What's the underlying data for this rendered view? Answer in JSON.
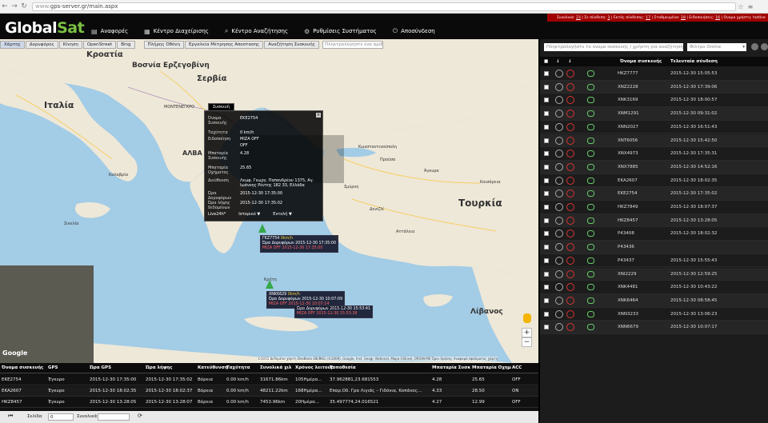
{
  "browser": {
    "url_prefix": "www.",
    "url_rest": "gps-server.gr/main.aspx"
  },
  "status": {
    "total_label": "Συνολικά:",
    "total": "23",
    "online_label": "Σε σύνδεση:",
    "online": "3",
    "offline_label": "Εκτός σύνδεσης:",
    "offline": "17",
    "stopped_label": "Σταθμευμένα:",
    "stopped": "18",
    "events_label": "Ειδοποιήσεις:",
    "events": "16",
    "user_label": "Ονομα χρήστη:",
    "user": "hotline"
  },
  "logo": {
    "part1": "Global",
    "part2": "Sat"
  },
  "nav": {
    "reports": "Αναφορές",
    "management": "Κέντρο Διαχείρισης",
    "search": "Κέντρο Αναζήτησης",
    "settings": "Ρυθμίσεις Συστήματος",
    "logout": "Αποσύνδεση"
  },
  "map_toolbar": {
    "map": "Χάρτης",
    "satellite": "Δορυφόρος",
    "traffic": "Κίνηση",
    "osm": "OpenStreet",
    "bing": "Bing",
    "fullscreen": "Πλήρης Οθόνη",
    "measure": "Εργαλεία Μέτρησης Αποστασης",
    "search_vehicles": "Αναζήτηση Συσκευής",
    "search_placeholder": "Πληκτρολογήστε ένα αριθμό"
  },
  "map_labels": {
    "croatia": "Κροατία",
    "bosnia": "Βοσνία Ερζεγοβίνη",
    "serbia": "Σερβία",
    "italy": "Ιταλία",
    "montenegro": "ΜΟΝΤΕΝΕΓΚΡΟ",
    "albania": "ΑΛΒΑ",
    "turkey": "Τουρκία",
    "lebanon": "Λίβανος",
    "crete": "Κρήτη",
    "kalabria": "Καλαβρία",
    "smyrni": "Σμύρνη",
    "ankara": "Άγκυρα",
    "konstantinoupoli": "Κωνσταντινούπολη",
    "antalya": "Αττάλεια",
    "sicilia": "Σικελία",
    "bursa": "Προύσα",
    "kayseri": "Καισάρεια",
    "denizli": "Δενιζλί"
  },
  "popup": {
    "tab": "Συσκευή",
    "rows": [
      {
        "label": "Όνομα Συσκευής",
        "value": "ΕΚΕ2754"
      },
      {
        "label": "Ταχύτητα",
        "value": "0 km/h"
      },
      {
        "label": "Ειδοποίηση",
        "value": "ΜΙΖΑ OFF"
      },
      {
        "label": "",
        "value": "OFF"
      },
      {
        "label": "Μπαταρία Συσκευής",
        "value": "4.28"
      },
      {
        "label": "Μπαταρία Οχήματος",
        "value": "25.65"
      },
      {
        "label": "Διεύθυνση",
        "value": "Λεωφ. Γεωργ. Παπανδρέου 1375, Αγ. Ιωάννης Ρέντης 182 33, Ελλάδα"
      },
      {
        "label": "Ώρα Δορυφόρων",
        "value": "2015-12-30 17:35:00"
      },
      {
        "label": "Ώρα λήψης δεδομένων",
        "value": "2015-12-30 17:35:02"
      }
    ],
    "foot_live": "Live24h*",
    "foot_history": "Ιστορικό ▼",
    "foot_commands": "Εντολή ▼"
  },
  "vlabels": {
    "a_name": "ΓΚΖ7754",
    "a_speed": "0km/h",
    "a_line2": "Ώρα Δορυφόρων 2015-12-30 17:35:00",
    "a_line3": "ΜΙΖΑ OFF 2015-12-30 17:35:00",
    "b_name": "XNK6629",
    "b_speed": "0km/h",
    "b_line2": "Ώρα Δορυφόρων 2015-12-30 10:07:09",
    "b_line3": "ΜΙΖΑ OFF 2015-12-30 10:07:14",
    "c_line2": "Ώρα Δορυφόρων 2015-12-30 15:53:41",
    "c_line3": "ΜΙΖΑ OFF 2015-12-30 15:53:38"
  },
  "attribution": "©2015 Δεδομένα χάρτη DeoBasis-DE/BKG (©2009), Google, Inst. Geogr. National, Mapa GISrael, ORION-ME   Όροι Χρήσης   Αναφορά σφάλματος χάρτη",
  "google": "Google",
  "right": {
    "search_placeholder": "Πληκτρολογήστε το όνομα συσκευής / χρήστη για αναζήτηση",
    "filter_placeholder": "Φίλτρο Online",
    "col_name": "Όνομα συσκευής",
    "col_last": "Τελευταία σύνδεση",
    "rows": [
      {
        "name": "HKZ7777",
        "date": "2015-12-30 15:05:53"
      },
      {
        "name": "XNZ2228",
        "date": "2015-12-30 17:39:06"
      },
      {
        "name": "XNK3169",
        "date": "2015-12-30 18:00:57"
      },
      {
        "name": "XNM1291",
        "date": "2015-12-30 09:31:02"
      },
      {
        "name": "XNN2027",
        "date": "2015-12-30 16:51:43"
      },
      {
        "name": "XNT6056",
        "date": "2015-12-30 15:42:50"
      },
      {
        "name": "XNX4973",
        "date": "2015-12-30 17:35:31"
      },
      {
        "name": "XNX7885",
        "date": "2015-12-30 14:52:16"
      },
      {
        "name": "EKA2607",
        "date": "2015-12-30 18:02:35"
      },
      {
        "name": "EKE2754",
        "date": "2015-12-30 17:35:02"
      },
      {
        "name": "HKZ7849",
        "date": "2015-12-30 18:07:37"
      },
      {
        "name": "HKZ8457",
        "date": "2015-12-30 13:28:05"
      },
      {
        "name": "P43408",
        "date": "2015-12-30 18:02:32"
      },
      {
        "name": "P43436",
        "date": ""
      },
      {
        "name": "P43437",
        "date": "2015-12-30 15:55:43"
      },
      {
        "name": "XNI2229",
        "date": "2015-12-30 12:59:25"
      },
      {
        "name": "XNK4481",
        "date": "2015-12-30 10:43:22"
      },
      {
        "name": "XNK6464",
        "date": "2015-12-30 08:58:45"
      },
      {
        "name": "XNN3233",
        "date": "2015-12-30 13:06:23"
      },
      {
        "name": "XNN6679",
        "date": "2015-12-30 10:07:17"
      }
    ]
  },
  "table": {
    "headers": [
      "Όνομα συσκευής",
      "GPS",
      "Ώρα GPS",
      "Ώρα λήψης",
      "Κατεύθυνση",
      "Ταχύτητα",
      "Συνολικά χιλ",
      "Χρόνος λειτουρ",
      "Τοποθεσία",
      "Μπαταρία Συσκ",
      "Μπαταρία Οχημ",
      "ACC"
    ],
    "rows": [
      [
        "EKE2754",
        "Έγκυρο",
        "2015-12-30 17:35:00",
        "2015-12-30 17:35:02",
        "Βόρεια",
        "0.00 km/h",
        "31671.86km",
        "105Ημέρα...",
        "37.962881,23.681553",
        "4.28",
        "25.65",
        "OFF"
      ],
      [
        "EKA2607",
        "Έγκυρο",
        "2015-12-30 18:02:35",
        "2015-12-30 18:02:37",
        "Βόρεια",
        "0.00 km/h",
        "48211.22km",
        "168Ημέρα...",
        "Επαρ.Οδ. Γρα Λιγιάς – Γιδόνια, Κοπάνος...",
        "4.33",
        "28.50",
        "ON"
      ],
      [
        "HKZ8457",
        "Έγκυρο",
        "2015-12-30 13:28:05",
        "2015-12-30 13:28:07",
        "Βόρεια",
        "0.00 km/h",
        "7453.96km",
        "20Ημέρα...",
        "35.497774,24.016521",
        "4.27",
        "12.99",
        "OFF"
      ]
    ]
  },
  "pager": {
    "page_label": "Σελίδα",
    "page": "0",
    "total_label": "Συνολικά:"
  }
}
